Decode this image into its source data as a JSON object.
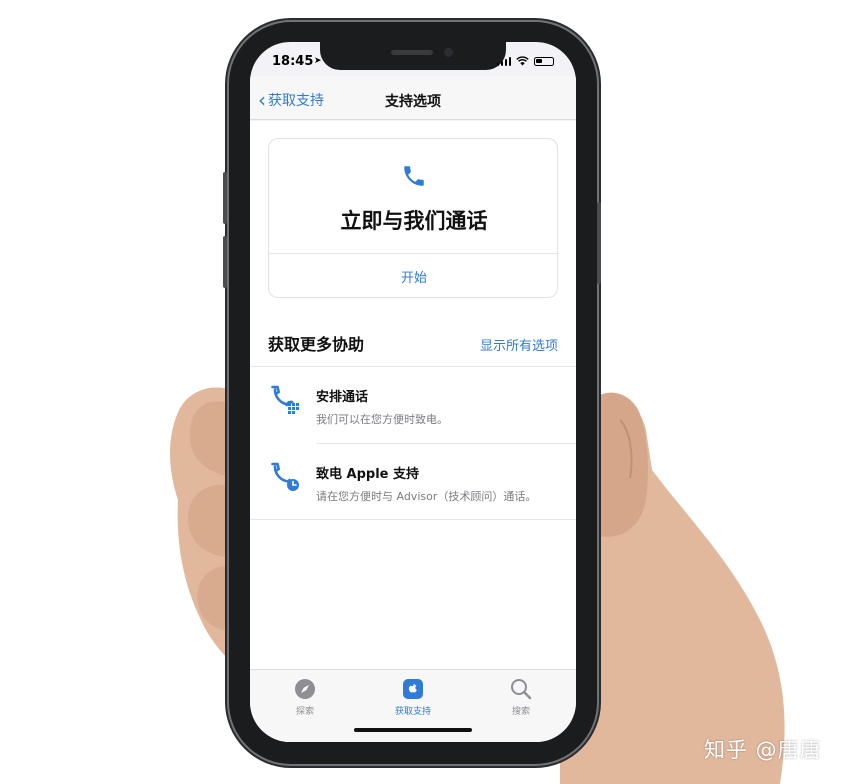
{
  "status_bar": {
    "time": "18:45"
  },
  "nav": {
    "back_label": "获取支持",
    "title": "支持选项"
  },
  "call_card": {
    "title": "立即与我们通话",
    "action": "开始"
  },
  "section": {
    "title": "获取更多协助",
    "link": "显示所有选项"
  },
  "options": [
    {
      "title": "安排通话",
      "subtitle": "我们可以在您方便时致电。",
      "icon": "phone-schedule-icon"
    },
    {
      "title": "致电 Apple 支持",
      "subtitle": "请在您方便时与 Advisor（技术顾问）通话。",
      "icon": "phone-clock-icon"
    }
  ],
  "tabs": [
    {
      "label": "探索",
      "icon": "compass-icon",
      "active": false
    },
    {
      "label": "获取支持",
      "icon": "apple-support-icon",
      "active": true
    },
    {
      "label": "搜索",
      "icon": "search-icon",
      "active": false
    }
  ],
  "watermark": "知乎 @唐唐",
  "colors": {
    "accent": "#2f7bd6",
    "background": "#ffffff",
    "tab_inactive": "#8e8e93"
  }
}
